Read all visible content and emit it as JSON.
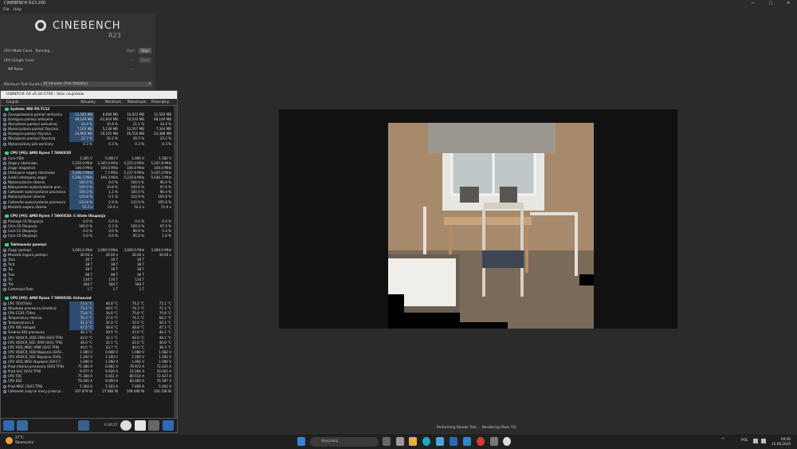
{
  "window": {
    "title": "CINEBENCH R23.200",
    "controls": [
      "—",
      "▢",
      "✕"
    ]
  },
  "menu": [
    "File",
    "Help"
  ],
  "cinebench": {
    "brand": "CINEBENCH",
    "version": "R23",
    "multi_label": "CPU (Multi Core)",
    "multi_status": "Running ...",
    "multi_pts": "0/pts",
    "stop_label": "Stop",
    "single_label": "CPU (Single Core)",
    "single_pts": "---",
    "start_label": "Start",
    "mp_label": "MP Ratio",
    "mp_value": "---",
    "duration_label": "Minimum Test Duration",
    "duration_value": "10 minutes (Test Stability)"
  },
  "hwinfo": {
    "title": "HWiNFO® 64 v6.26-5700 - Stan czujników",
    "headers": [
      "Czujnik",
      "Aktualny",
      "Minimum",
      "Maksimum",
      "Przeciętny"
    ],
    "groups": [
      {
        "name": "System: MSI PX-7C12",
        "rows": [
          [
            "Zaangażowana pamięć wirtualna",
            "11,583 MB",
            "8,699 MB",
            "16,833 MB",
            "11,583 MB"
          ],
          [
            "Dostępna pamięć wirtualna",
            "68,149 MB",
            "62,830 MB",
            "70,033 MB",
            "68,149 MB"
          ],
          [
            "Obciążenie pamięci wirtualnej",
            "14.4 %",
            "10.8 %",
            "21.1 %",
            "14.4 %"
          ],
          [
            "Wykorzystana pamięć fizyczna",
            "7,163 MB",
            "5,136 MB",
            "12,507 MB",
            "7,344 MB"
          ],
          [
            "Dostępna pamięć fizyczna",
            "24,960 MB",
            "19,145 MB",
            "26,518 MB",
            "24,388 MB"
          ],
          [
            "Obciążenie pamięci fizycznej",
            "22.7 %",
            "16.2 %",
            "39.5 %",
            "23.2 %"
          ],
          [
            "Wykorzystany plik wymiany",
            "0.3 %",
            "0.3 %",
            "0.3 %",
            "0.3 %"
          ]
        ]
      },
      {
        "name": "CPU [#0]: AMD Ryzen 7 5800X3D",
        "rows": [
          [
            "Core VIDs",
            "1.085 V",
            "0.800 V",
            "1.090 V",
            "1.082 V"
          ],
          [
            "Zegary rdzeniowe",
            "5,220.0 MHz",
            "2,345.0 MHz",
            "5,225.0 MHz",
            "5,167.8 MHz"
          ],
          [
            "Zegar magistrali",
            "100.0 MHz",
            "100.0 MHz",
            "100.0 MHz",
            "100.0 MHz"
          ],
          [
            "Efektywne zegary rdzeniowe",
            "5,206.3 MHz",
            "7.2 MHz",
            "5,217.9 MHz",
            "5,025.2 MHz"
          ],
          [
            "Średni efektywny zegar",
            "5,206.3 MHz",
            "194.3 MHz",
            "5,210.8 MHz",
            "5,026.3 MHz"
          ],
          [
            "Wykorzystanie rdzenia",
            "100.0 %",
            "0.0 %",
            "100.0 %",
            "96.4 %"
          ],
          [
            "Maksymalne wykorzystanie proc...",
            "100.0 %",
            "10.8 %",
            "100.0 %",
            "97.6 %"
          ],
          [
            "Całkowite wykorzystanie procesora",
            "100.0 %",
            "1.1 %",
            "100.0 %",
            "96.4 %"
          ],
          [
            "Wykorzystanie rdzenia",
            "110.8 %",
            "0.1 %",
            "110.9 %",
            "105.8 %"
          ],
          [
            "Całkowite wykorzystanie procesora",
            "110.8 %",
            "2.9 %",
            "110.9 %",
            "105.8 %"
          ],
          [
            "Mnożnik zegara rdzenia",
            "52.2 x",
            "23.4 x",
            "52.2 x",
            "51.9 x"
          ]
        ]
      },
      {
        "name": "CPU [#0]: AMD Ryzen 7 5800X3D: C-State Okupacja",
        "rows": [
          [
            "Package C6 Okupacja",
            "0.0 %",
            "0.0 %",
            "0.0 %",
            "0.0 %"
          ],
          [
            "Core C0 Okupacja",
            "100.0 %",
            "0.3 %",
            "100.0 %",
            "97.0 %"
          ],
          [
            "Core C1 Okupacja",
            "0.0 %",
            "0.0 %",
            "89.9 %",
            "1.4 %"
          ],
          [
            "Core C6 Okupacja",
            "0.0 %",
            "0.0 %",
            "95.0 %",
            "1.6 %"
          ]
        ]
      },
      {
        "name": "Taktowanie pamięci",
        "rows": [
          [
            "Zegar pamięci",
            "3,000.0 MHz",
            "3,000.0 MHz",
            "3,000.0 MHz",
            "3,000.0 MHz"
          ],
          [
            "Mnożnik zegara pamięci",
            "30.00 x",
            "30.00 x",
            "30.00 x",
            "30.00 x"
          ],
          [
            "Tcas",
            "30 T",
            "30 T",
            "30 T",
            ""
          ],
          [
            "Trcd",
            "38 T",
            "38 T",
            "38 T",
            ""
          ],
          [
            "Trp",
            "38 T",
            "38 T",
            "38 T",
            ""
          ],
          [
            "Tras",
            "96 T",
            "96 T",
            "96 T",
            ""
          ],
          [
            "Trc",
            "134 T",
            "134 T",
            "134 T",
            ""
          ],
          [
            "Trfc",
            "584 T",
            "584 T",
            "584 T",
            ""
          ],
          [
            "Command Rate",
            "1 T",
            "1 T",
            "1 T",
            ""
          ]
        ]
      },
      {
        "name": "CPU [#0]: AMD Ryzen 7 5800X3D: Enhanced",
        "rows": [
          [
            "CPU (Tctl/Tdie)",
            "72.4 °C",
            "46.8 °C",
            "74.2 °C",
            "72.1 °C"
          ],
          [
            "Obudowa procesora (średnia)",
            "73.2 °C",
            "48.6 °C",
            "74.3 °C",
            "71.3 °C"
          ],
          [
            "CPU CCD1 (Tdie)",
            "72.8 °C",
            "34.8 °C",
            "75.8 °C",
            "70.8 °C"
          ],
          [
            "Temperatury rdzenia",
            "70.3 °C",
            "27.0 °C",
            "74.1 °C",
            "68.2 °C"
          ],
          [
            "Temperatura L3",
            "51.3 °C",
            "31.0 °C",
            "52.0 °C",
            "50.1 °C"
          ],
          [
            "CPU IOD Hotspot",
            "47.5 °C",
            "48.8 °C",
            "48.8 °C",
            "47.3 °C"
          ],
          [
            "Średnia IOD procesora",
            "46.3 °C",
            "39.5 °C",
            "47.0 °C",
            "46.1 °C"
          ],
          [
            "CPU VDDCR_VDD VRM (SVI3 TFN)",
            "42.0 °C",
            "32.1 °C",
            "42.0 °C",
            "40.1 °C"
          ],
          [
            "CPU VDDCR_SOC VRM (SVI3 TFN)",
            "36.0 °C",
            "31.1 °C",
            "42.0 °C",
            "40.0 °C"
          ],
          [
            "CPU VDD_MISC VRM (SVI3 TFN)",
            "40.0 °C",
            "33.7 °C",
            "40.0 °C",
            "38.3 °C"
          ],
          [
            "CPU VDDCR_VDD Napięcie (SVI3...",
            "1.085 V",
            "0.948 V",
            "1.089 V",
            "1.082 V"
          ],
          [
            "CPU VDDCR_SOC Napięcie (SVI3...",
            "1.200 V",
            "1.200 V",
            "1.200 V",
            "1.200 V"
          ],
          [
            "CPU VDD_MISC Napięcie (SVI3 T...",
            "1.090 V",
            "1.090 V",
            "1.092 V",
            "1.090 V"
          ],
          [
            "Prąd rdzenia procesora (SVI3 TFN)",
            "75.380 A",
            "0.692 A",
            "79.972 A",
            "72.425 A"
          ],
          [
            "Prąd SoC (SVI3 TFN)",
            "9.977 A",
            "9.926 A",
            "12.284 A",
            "10.022 A"
          ],
          [
            "CPU TDC",
            "75.380 A",
            "0.651 A",
            "80.514 A",
            "72.427 A"
          ],
          [
            "CPU EDC",
            "79.000 A",
            "9.000 A",
            "83.000 A",
            "76.587 A"
          ],
          [
            "Prąd MISC (SVI3 TFN)",
            "5.364 A",
            "5.103 A",
            "7.408 A",
            "5.462 A"
          ],
          [
            "Całkowite zużycie mocy przez pr...",
            "107.879 W",
            "27.082 W",
            "109.490 W",
            "104.138 W"
          ]
        ]
      }
    ],
    "timer": "0:20:27"
  },
  "render": {
    "status": "Performing Render Test ... Rendering (Pass 15)"
  },
  "taskbar": {
    "weather_temp": "27°C",
    "weather_desc": "Słonecznie",
    "search_placeholder": "Wyszukaj",
    "lang": "POL",
    "time": "09:46",
    "date": "15.08.2024"
  }
}
